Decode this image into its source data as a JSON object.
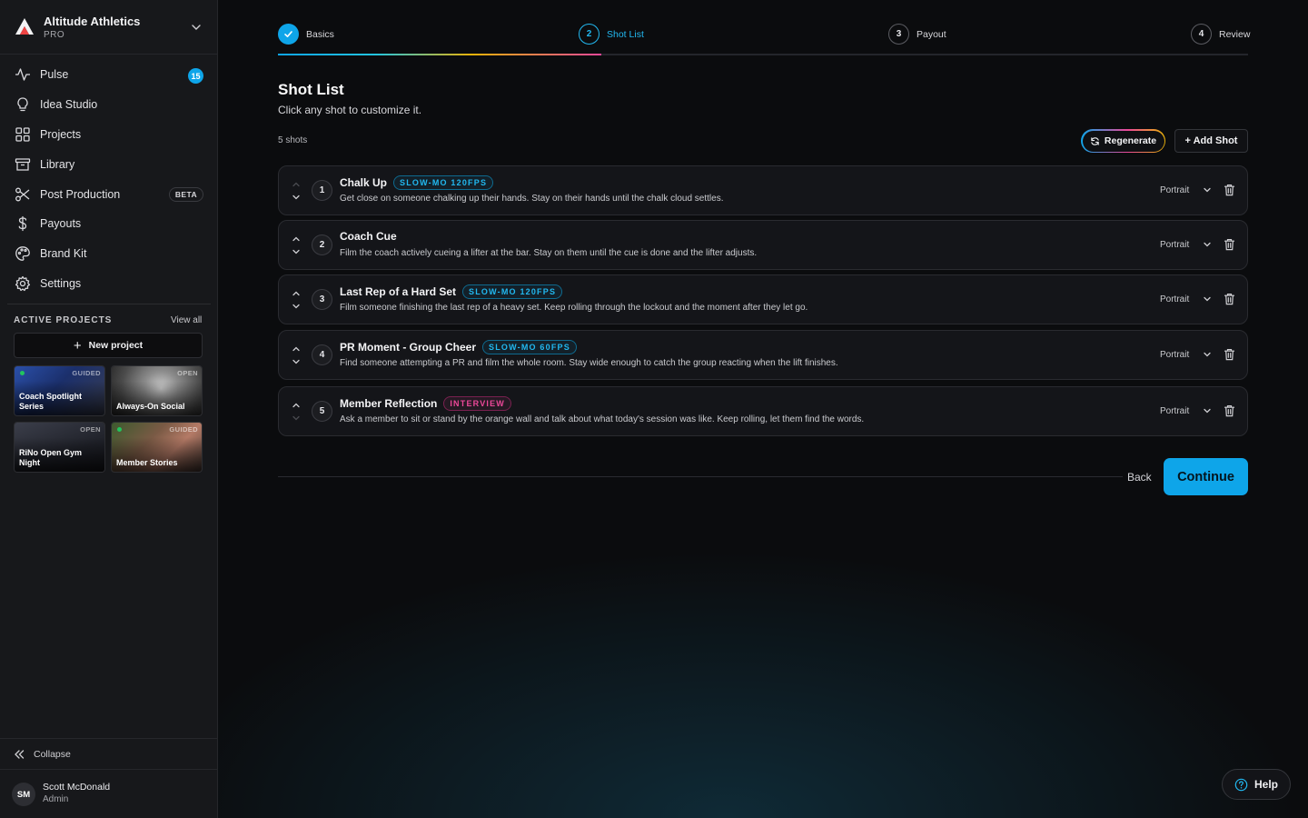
{
  "sidebar": {
    "org": {
      "name": "Altitude Athletics",
      "tier": "PRO"
    },
    "nav": [
      {
        "label": "Pulse",
        "icon": "pulse-icon",
        "badge": "15"
      },
      {
        "label": "Idea Studio",
        "icon": "lightbulb-icon"
      },
      {
        "label": "Projects",
        "icon": "grid-icon"
      },
      {
        "label": "Library",
        "icon": "archive-icon"
      },
      {
        "label": "Post Production",
        "icon": "scissors-icon",
        "badge": "BETA"
      },
      {
        "label": "Payouts",
        "icon": "dollar-icon"
      },
      {
        "label": "Brand Kit",
        "icon": "palette-icon"
      },
      {
        "label": "Settings",
        "icon": "gear-icon"
      }
    ],
    "active_projects": {
      "title": "ACTIVE PROJECTS",
      "view_all": "View all",
      "new_project": "New project",
      "projects": [
        {
          "name": "Coach Spotlight Series",
          "status": "GUIDED"
        },
        {
          "name": "Always-On Social",
          "status": "OPEN"
        },
        {
          "name": "RiNo Open Gym Night",
          "status": "OPEN"
        },
        {
          "name": "Member Stories",
          "status": "GUIDED"
        }
      ]
    },
    "collapse": "Collapse",
    "user": {
      "initials": "SM",
      "name": "Scott McDonald",
      "role": "Admin"
    }
  },
  "stepper": {
    "steps": [
      {
        "number": "1",
        "label": "Basics",
        "state": "done"
      },
      {
        "number": "2",
        "label": "Shot List",
        "state": "active"
      },
      {
        "number": "3",
        "label": "Payout",
        "state": "upcoming"
      },
      {
        "number": "4",
        "label": "Review",
        "state": "upcoming"
      }
    ],
    "progress_fraction": 0.333
  },
  "main": {
    "title": "Shot List",
    "subtitle": "Click any shot to customize it.",
    "shot_count": "5 shots",
    "regenerate_label": "Regenerate",
    "add_shot_label": "+ Add Shot",
    "back_label": "Back",
    "continue_label": "Continue",
    "help_label": "Help"
  },
  "shots": [
    {
      "number": "1",
      "title": "Chalk Up",
      "tag": "SLOW-MO 120FPS",
      "tag_type": "slowmo",
      "description": "Get close on someone chalking up their hands. Stay on their hands until the chalk cloud settles.",
      "orientation": "Portrait"
    },
    {
      "number": "2",
      "title": "Coach Cue",
      "tag": "",
      "tag_type": "",
      "description": "Film the coach actively cueing a lifter at the bar. Stay on them until the cue is done and the lifter adjusts.",
      "orientation": "Portrait"
    },
    {
      "number": "3",
      "title": "Last Rep of a Hard Set",
      "tag": "SLOW-MO 120FPS",
      "tag_type": "slowmo",
      "description": "Film someone finishing the last rep of a heavy set. Keep rolling through the lockout and the moment after they let go.",
      "orientation": "Portrait"
    },
    {
      "number": "4",
      "title": "PR Moment - Group Cheer",
      "tag": "SLOW-MO 60FPS",
      "tag_type": "slowmo",
      "description": "Find someone attempting a PR and film the whole room. Stay wide enough to catch the group reacting when the lift finishes.",
      "orientation": "Portrait"
    },
    {
      "number": "5",
      "title": "Member Reflection",
      "tag": "INTERVIEW",
      "tag_type": "interview",
      "description": "Ask a member to sit or stand by the orange wall and talk about what today's session was like. Keep rolling, let them find the words.",
      "orientation": "Portrait"
    }
  ],
  "colors": {
    "accent": "#0ea5e9",
    "slowmo_tag": "#22b8f0",
    "interview_tag": "#ec4899",
    "background": "#0b0c0e",
    "sidebar": "#17181b"
  }
}
